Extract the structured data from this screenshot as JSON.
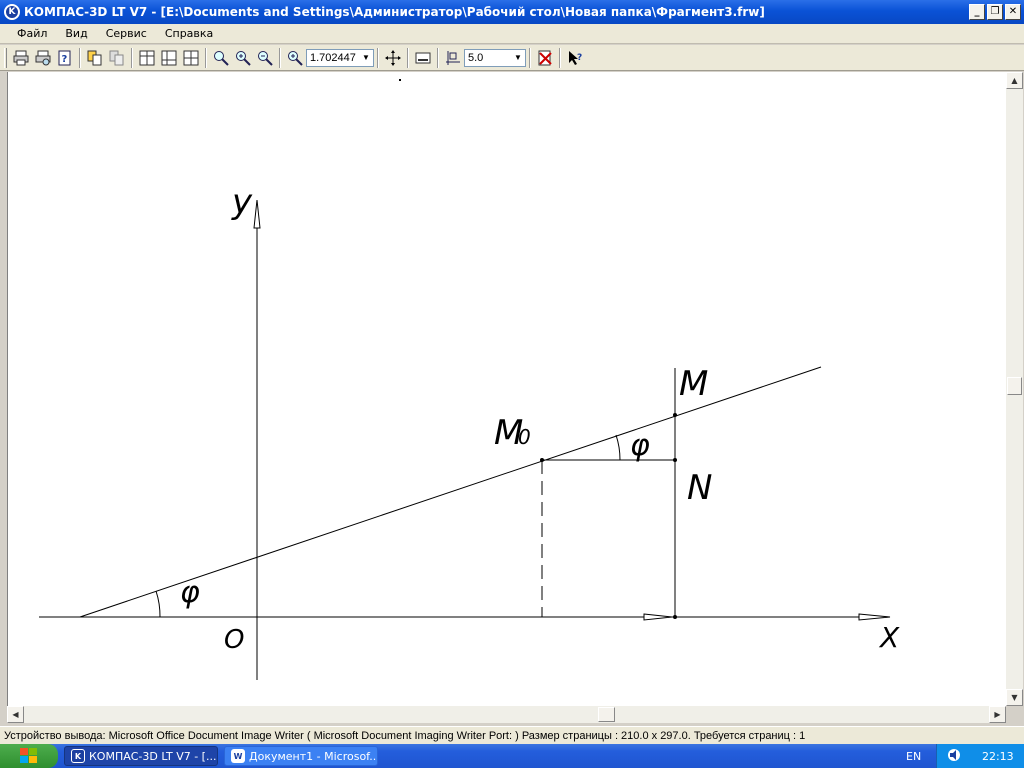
{
  "window": {
    "title": "КОМПАС-3D LT V7 - [E:\\Documents and Settings\\Администратор\\Рабочий стол\\Новая папка\\Фрагмент3.frw]",
    "app_icon": "kompas-logo-icon",
    "controls": [
      "minimize-icon",
      "restore-icon",
      "close-icon"
    ]
  },
  "menu": {
    "items": [
      "Файл",
      "Вид",
      "Сервис",
      "Справка"
    ]
  },
  "toolbar": {
    "zoom_value": "1.702447",
    "step_value": "5.0",
    "icons": [
      "print-icon",
      "print-preview-icon",
      "help-doc-icon",
      "copy-props-icon",
      "paste-props-icon",
      "view-all-icon",
      "view-grid-icon",
      "view-layout-icon",
      "zoom-window-icon",
      "zoom-in-icon",
      "zoom-out-icon",
      "zoom-scale-icon",
      "pan-icon",
      "redraw-icon",
      "cursor-step-icon",
      "check-icon",
      "context-help-icon"
    ]
  },
  "drawing": {
    "label_y": "y",
    "label_x": "X",
    "label_o": "O",
    "label_m": "M",
    "label_m0": "M",
    "label_m0_sub": "0",
    "label_n": "N",
    "label_phi_top": "φ",
    "label_phi_bottom": "φ",
    "line_color": "#000000",
    "background": "#ffffff"
  },
  "status": {
    "text": "Устройство вывода: Microsoft Office Document Image Writer ( Microsoft Document Imaging Writer Port: )  Размер страницы : 210.0 x 297.0.  Требуется страниц : 1"
  },
  "taskbar": {
    "tasks": [
      {
        "label": "КОМПАС-3D LT V7 - [...",
        "icon": "kompas-task-icon",
        "active": true
      },
      {
        "label": "Документ1 - Microsof...",
        "icon": "word-task-icon",
        "active": false
      }
    ],
    "language": "EN",
    "clock": "22:13",
    "tray_icons": [
      "volume-icon"
    ]
  }
}
